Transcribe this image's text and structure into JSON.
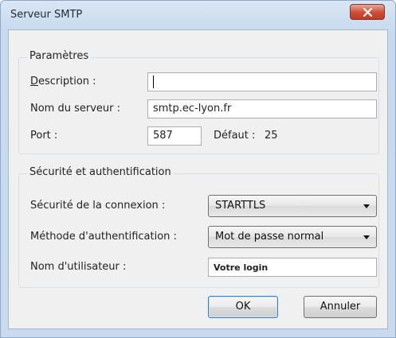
{
  "window": {
    "title": "Serveur SMTP"
  },
  "parametres": {
    "group_title": "Paramètres",
    "description_label": "Description :",
    "description_value": "",
    "server_label": "Nom du serveur :",
    "server_value": "smtp.ec-lyon.fr",
    "port_label": "Port :",
    "port_value": "587",
    "default_label": "Défaut :",
    "default_value": "25"
  },
  "securite": {
    "group_title": "Sécurité et authentification",
    "connection_label": "Sécurité de la connexion :",
    "connection_value": "STARTTLS",
    "auth_label": "Méthode d'authentification :",
    "auth_value": "Mot de passe normal",
    "username_label": "Nom d'utilisateur :",
    "username_value": "Votre login"
  },
  "buttons": {
    "ok_label": "OK",
    "cancel_label": "Annuler"
  },
  "colors": {
    "close_button": "#c94a35",
    "window_frame": "#c9daee",
    "dialog_background": "#f0f0f0"
  },
  "icons": {
    "close": "close-icon",
    "dropdown": "chevron-down-icon"
  }
}
